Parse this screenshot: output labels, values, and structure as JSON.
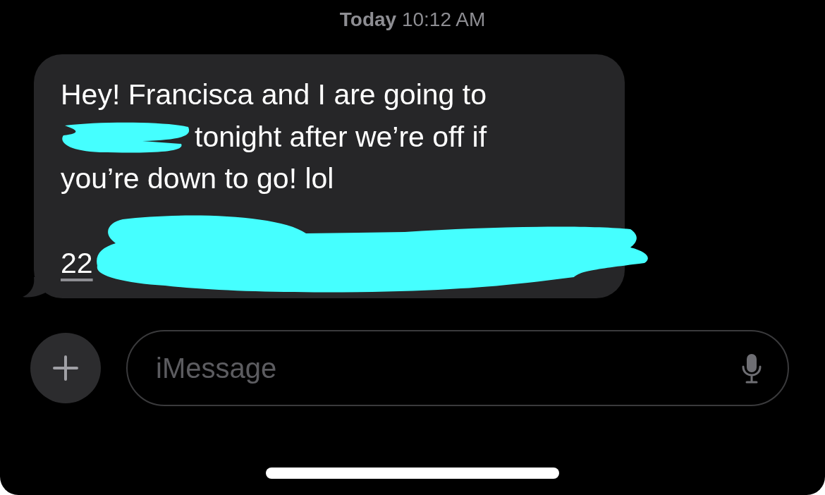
{
  "timestamp": {
    "day": "Today",
    "time": "10:12 AM"
  },
  "message": {
    "lines": [
      {
        "text": "Hey! Francisca and I are going to",
        "redacted_before": false,
        "link": false,
        "redacted_after": false
      },
      {
        "text": "tonight after we’re off if",
        "redacted_before": true,
        "link": false,
        "redacted_after": false
      },
      {
        "text": "you’re down to go! lol",
        "redacted_before": false,
        "link": false,
        "redacted_after": false
      },
      {
        "text": "22",
        "redacted_before": false,
        "link": true,
        "redacted_after": true
      }
    ]
  },
  "composer": {
    "placeholder": "iMessage"
  }
}
